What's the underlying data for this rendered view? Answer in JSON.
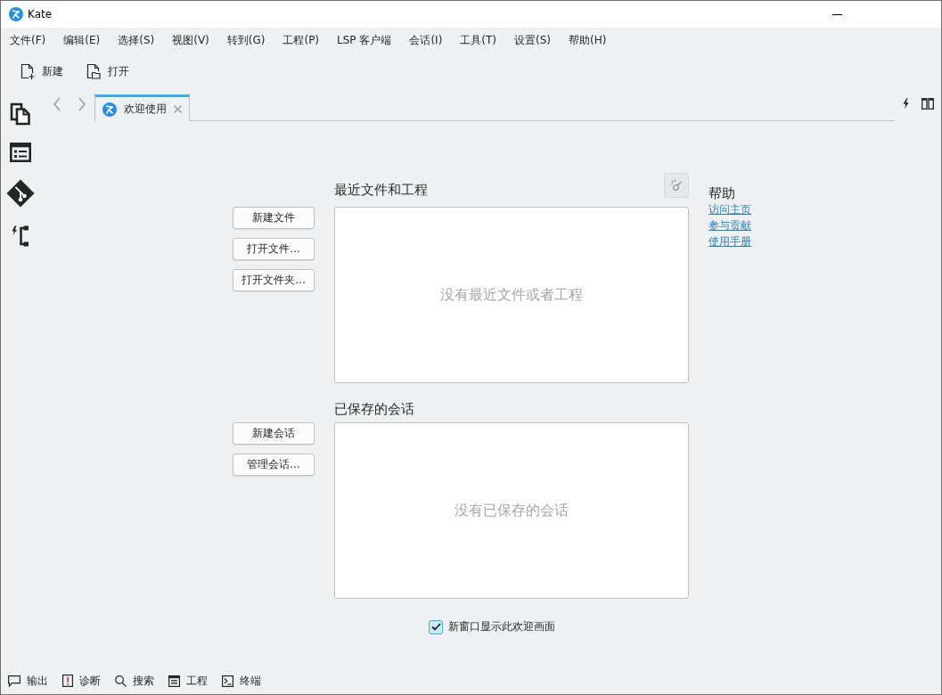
{
  "window": {
    "title": "Kate"
  },
  "menu_bar": [
    "文件(F)",
    "编辑(E)",
    "选择(S)",
    "视图(V)",
    "转到(G)",
    "工程(P)",
    "LSP 客户端",
    "会话(I)",
    "工具(T)",
    "设置(S)",
    "帮助(H)"
  ],
  "toolbar": [
    {
      "kind": "new",
      "label": "新建"
    },
    {
      "kind": "open",
      "label": "打开"
    }
  ],
  "tabs": [
    {
      "label": "欢迎使用",
      "selected": true
    }
  ],
  "welcome": {
    "recent": {
      "title": "最近文件和工程",
      "empty_text": "没有最近文件或者工程",
      "buttons": [
        "新建文件",
        "打开文件...",
        "打开文件夹..."
      ]
    },
    "help": {
      "title": "帮助",
      "links": [
        "访问主页",
        "参与贡献",
        "使用手册"
      ]
    },
    "sessions": {
      "title": "已保存的会话",
      "empty_text": "没有已保存的会话",
      "buttons": [
        "新建会话",
        "管理会话..."
      ]
    },
    "show_on_new_window": {
      "label": "新窗口显示此欢迎画面",
      "checked": true
    }
  },
  "bottom_panel": [
    {
      "kind": "output",
      "label": "输出"
    },
    {
      "kind": "diagnostics",
      "label": "诊断"
    },
    {
      "kind": "search",
      "label": "搜索"
    },
    {
      "kind": "project",
      "label": "工程"
    },
    {
      "kind": "terminal",
      "label": "终端"
    }
  ]
}
